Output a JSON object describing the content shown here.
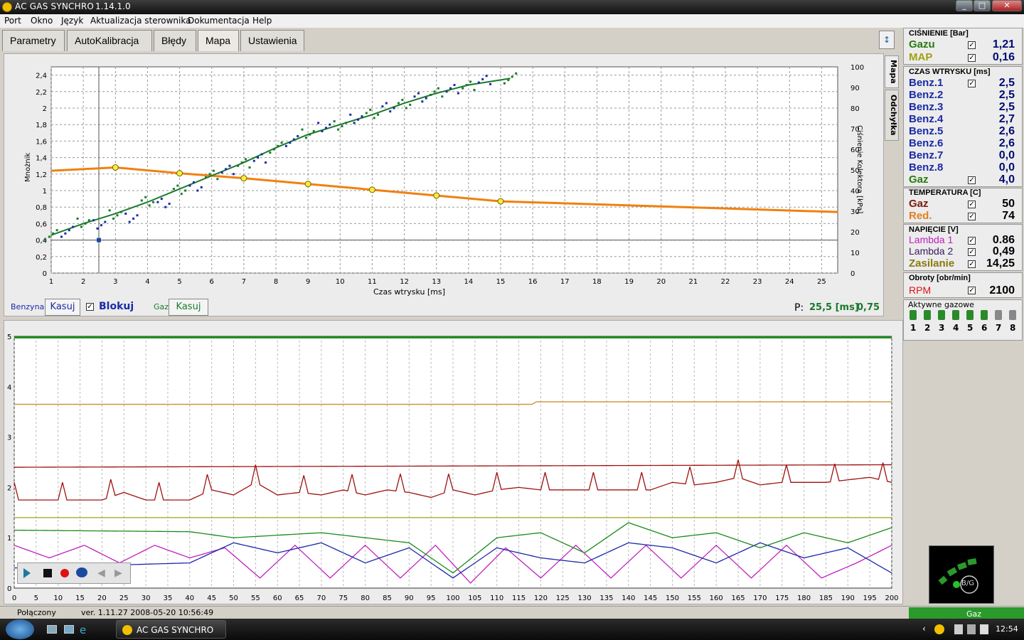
{
  "window": {
    "title": "AC GAS SYNCHRO",
    "version": "1.14.1.0"
  },
  "menu": [
    "Port",
    "Okno",
    "Język",
    "Aktualizacja sterownika",
    "Dokumentacja",
    "Help"
  ],
  "tabs": [
    {
      "label": "Parametry"
    },
    {
      "label": "AutoKalibracja"
    },
    {
      "label": "Błędy"
    },
    {
      "label": "Mapa"
    },
    {
      "label": "Ustawienia"
    }
  ],
  "side_tabs": [
    "Mapa",
    "Odchyłka"
  ],
  "map_chart": {
    "ylabel": "Mnożnik",
    "y2label": "Ciśnienie Kolektora [kPa]",
    "xlabel": "Czas wtrysku [ms]",
    "yticks": [
      "0",
      "0,2",
      "0,4",
      "0,6",
      "0,8",
      "1",
      "1,2",
      "1,4",
      "1,6",
      "1,8",
      "2",
      "2,2",
      "2,4"
    ],
    "y2ticks": [
      "0",
      "10",
      "20",
      "30",
      "40",
      "50",
      "60",
      "70",
      "80",
      "90",
      "100"
    ],
    "xticks": [
      "1",
      "2",
      "3",
      "4",
      "5",
      "6",
      "7",
      "8",
      "9",
      "10",
      "11",
      "12",
      "13",
      "14",
      "15",
      "16",
      "17",
      "18",
      "19",
      "20",
      "21",
      "22",
      "23",
      "24",
      "25"
    ]
  },
  "chart_data": [
    {
      "type": "line",
      "title": "",
      "xlabel": "Czas wtrysku [ms]",
      "ylabel": "Mnożnik",
      "y2label": "Ciśnienie Kolektora [kPa]",
      "xlim": [
        1,
        25.5
      ],
      "ylim": [
        0,
        2.5
      ],
      "y2lim": [
        0,
        100
      ],
      "series": [
        {
          "name": "Mnożnik",
          "color": "#f08010",
          "x": [
            1,
            3,
            5,
            7,
            9,
            11,
            13,
            15,
            25.5
          ],
          "y": [
            1.24,
            1.28,
            1.21,
            1.15,
            1.08,
            1.01,
            0.94,
            0.87,
            0.74
          ]
        },
        {
          "name": "Gaz",
          "color": "#1a7a2a",
          "x": [
            1,
            2,
            3,
            4,
            5,
            6,
            7,
            8,
            9,
            10,
            11,
            12,
            13,
            14,
            15.3
          ],
          "y": [
            0.46,
            0.6,
            0.72,
            0.86,
            1.02,
            1.18,
            1.34,
            1.52,
            1.68,
            1.8,
            1.92,
            2.06,
            2.18,
            2.28,
            2.36
          ]
        },
        {
          "name": "Benzyna",
          "color": "#1a2aa8",
          "x": [
            1.5,
            2.5,
            3.5,
            4.5,
            5.5,
            6.5,
            7.5,
            8.5,
            9.5,
            10.5,
            11.5,
            12.5,
            13.5,
            14.5
          ],
          "y": [
            0.5,
            0.58,
            0.68,
            0.84,
            1.06,
            1.24,
            1.4,
            1.6,
            1.76,
            1.88,
            2.0,
            2.14,
            2.22,
            2.35
          ]
        }
      ]
    },
    {
      "type": "line",
      "title": "",
      "xlabel": "",
      "ylabel": "",
      "xlim": [
        0,
        200
      ],
      "ylim": [
        0,
        5
      ],
      "xticks": [
        "0",
        "5",
        "10",
        "15",
        "20",
        "25",
        "30",
        "35",
        "40",
        "45",
        "50",
        "55",
        "60",
        "65",
        "70",
        "75",
        "80",
        "85",
        "90",
        "95",
        "100",
        "105",
        "110",
        "115",
        "120",
        "125",
        "130",
        "135",
        "140",
        "145",
        "150",
        "155",
        "160",
        "165",
        "170",
        "175",
        "180",
        "185",
        "190",
        "195",
        "200"
      ],
      "yticks": [
        "0",
        "1",
        "2",
        "3",
        "4",
        "5"
      ],
      "series": [
        {
          "name": "Gaz",
          "color": "#1a8a1a",
          "x": [
            0,
            200
          ],
          "y": [
            4.98,
            4.98
          ]
        },
        {
          "name": "Red.",
          "color": "#c89030",
          "x": [
            0,
            118,
            119,
            200
          ],
          "y": [
            3.65,
            3.65,
            3.7,
            3.7
          ]
        },
        {
          "name": "Gaz temp",
          "color": "#a01010",
          "x": [
            0,
            10,
            20,
            25,
            30,
            40,
            45,
            50,
            55,
            60,
            65,
            70,
            75,
            80,
            85,
            90,
            95,
            100,
            105,
            110,
            115,
            120,
            125,
            130,
            135,
            140,
            145,
            150,
            155,
            160,
            165,
            170,
            175,
            180,
            185,
            190,
            195,
            200
          ],
          "y": [
            1.75,
            1.75,
            1.75,
            1.9,
            1.75,
            1.75,
            1.95,
            1.85,
            2.1,
            1.85,
            1.9,
            1.85,
            1.95,
            1.85,
            1.95,
            1.9,
            1.8,
            1.95,
            1.85,
            1.95,
            2.0,
            1.95,
            1.95,
            1.95,
            1.95,
            1.95,
            1.95,
            2.1,
            2.05,
            2.1,
            2.2,
            2.05,
            2.1,
            2.1,
            2.1,
            2.15,
            2.2,
            2.1
          ]
        },
        {
          "name": "Zasilanie",
          "color": "#a01010",
          "x": [
            0,
            200
          ],
          "y": [
            2.4,
            2.45
          ]
        },
        {
          "name": "Lambda 1",
          "color": "#c020c0",
          "x": [
            0,
            8,
            16,
            24,
            32,
            40,
            48,
            56,
            64,
            72,
            80,
            88,
            96,
            104,
            112,
            120,
            128,
            136,
            144,
            152,
            160,
            168,
            176,
            184,
            192,
            200
          ],
          "y": [
            0.85,
            0.6,
            0.85,
            0.5,
            0.85,
            0.6,
            0.8,
            0.2,
            0.85,
            0.2,
            0.85,
            0.2,
            0.85,
            0.1,
            0.8,
            0.2,
            0.85,
            0.2,
            0.85,
            0.2,
            0.85,
            0.2,
            0.85,
            0.2,
            0.5,
            0.85
          ]
        },
        {
          "name": "Lambda 2",
          "color": "#1a2aa8",
          "x": [
            0,
            20,
            40,
            50,
            60,
            70,
            80,
            90,
            100,
            110,
            120,
            130,
            140,
            150,
            160,
            170,
            180,
            190,
            200
          ],
          "y": [
            0.4,
            0.45,
            0.5,
            0.9,
            0.7,
            0.9,
            0.5,
            0.8,
            0.2,
            0.8,
            0.6,
            0.5,
            0.9,
            0.8,
            0.5,
            0.9,
            0.6,
            0.8,
            0.3
          ]
        },
        {
          "name": "Obroty",
          "color": "#1a8a1a",
          "x": [
            0,
            40,
            50,
            70,
            90,
            100,
            110,
            120,
            130,
            140,
            150,
            160,
            170,
            180,
            190,
            200
          ],
          "y": [
            1.15,
            1.12,
            1.0,
            1.1,
            0.9,
            0.3,
            1.0,
            1.1,
            0.7,
            1.3,
            1.0,
            1.1,
            0.8,
            1.1,
            0.9,
            1.2
          ]
        },
        {
          "name": "Benz.",
          "color": "#a0a010",
          "x": [
            0,
            200
          ],
          "y": [
            1.4,
            1.4
          ]
        }
      ]
    }
  ],
  "map_controls": {
    "benzyna": "Benzyna",
    "kasuj": "Kasuj",
    "blokuj": "Blokuj",
    "gaz": "Gaz",
    "kasuj2": "Kasuj",
    "p_label": "P:",
    "p_ms": "25,5 [ms]",
    "p_val": "0,75"
  },
  "pressure": {
    "header": "CIŚNIENIE [Bar]",
    "rows": [
      {
        "label": "Gazu",
        "value": "1,21",
        "color": "#2a7a10"
      },
      {
        "label": "MAP",
        "value": "0,16",
        "color": "#a0a010"
      }
    ]
  },
  "inject": {
    "header": "CZAS WTRYSKU  [ms]",
    "rows": [
      {
        "label": "Benz.1",
        "value": "2,5"
      },
      {
        "label": "Benz.2",
        "value": "2,5"
      },
      {
        "label": "Benz.3",
        "value": "2,5"
      },
      {
        "label": "Benz.4",
        "value": "2,7"
      },
      {
        "label": "Benz.5",
        "value": "2,6"
      },
      {
        "label": "Benz.6",
        "value": "2,6"
      },
      {
        "label": "Benz.7",
        "value": "0,0"
      },
      {
        "label": "Benz.8",
        "value": "0,0"
      },
      {
        "label": "Gaz",
        "value": "4,0"
      }
    ]
  },
  "temp": {
    "header": "TEMPERATURA  [C]",
    "rows": [
      {
        "label": "Gaz",
        "value": "50",
        "color": "#7a1a10"
      },
      {
        "label": "Red.",
        "value": "74",
        "color": "#e08020"
      }
    ]
  },
  "voltage": {
    "header": "NAPIĘCIE [V]",
    "rows": [
      {
        "label": "Lambda 1",
        "value": "0.86",
        "color": "#c020c0"
      },
      {
        "label": "Lambda 2",
        "value": "0,49",
        "color": "#3a1a60"
      },
      {
        "label": "Zasilanie",
        "value": "14,25",
        "color": "#8a7a10"
      }
    ]
  },
  "rpm": {
    "header": "Obroty [obr/min]",
    "label": "RPM",
    "value": "2100"
  },
  "active": {
    "header": "Aktywne gazowe",
    "nums": [
      "1",
      "2",
      "3",
      "4",
      "5",
      "6",
      "7",
      "8"
    ]
  },
  "logo": {
    "text": "B/G"
  },
  "status": {
    "conn": "Połączony",
    "ver": "ver. 1.11.27   2008-05-20  10:56:49",
    "mode": "Gaz"
  },
  "taskbar": {
    "app": "AC GAS SYNCHRO",
    "clock": "12:54"
  }
}
